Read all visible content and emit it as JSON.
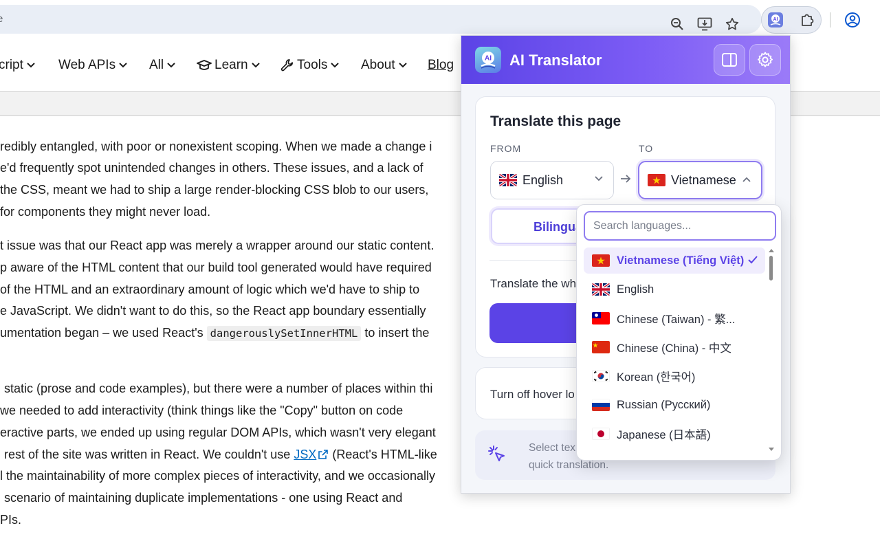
{
  "browser": {
    "omnibox_text": "e",
    "zoom_icon": "zoom-icon",
    "install_icon": "install-app-icon",
    "bookmark_icon": "star-icon",
    "extension_icon": "ai-translator-extension-icon",
    "extensions_icon": "puzzle-icon",
    "profile_icon": "profile-icon"
  },
  "nav": {
    "items": [
      {
        "label": "cript"
      },
      {
        "label": "Web APIs"
      },
      {
        "label": "All"
      },
      {
        "label": "Learn"
      },
      {
        "label": "Tools"
      },
      {
        "label": "About"
      },
      {
        "label": "Blog"
      }
    ]
  },
  "article": {
    "lines": [
      "redibly entangled, with poor or nonexistent scoping. When we made a change i",
      "e'd frequently spot unintended changes in others. These issues, and a lack of",
      "the CSS, meant we had to ship a large render-blocking CSS blob to our users,",
      "for components they might never load.",
      "t issue was that our React app was merely a wrapper around our static content.",
      "p aware of the HTML content that our build tool generated would have required",
      "of the HTML and an extraordinary amount of logic which we'd have to ship to",
      "e JavaScript. We didn't want to do this, so the React app boundary essentially",
      "umentation began – we used React's",
      "dangerouslySetInnerHTML",
      "to insert the",
      "static (prose and code examples), but there were a number of places within thi",
      "we needed to add interactivity (think things like the \"Copy\" button on code",
      "eractive parts, we ended up using regular DOM APIs, which wasn't very elegant",
      "rest of the site was written in React. We couldn't use",
      "JSX",
      "(React's HTML-like",
      "l the maintainability of more complex pieces of interactivity, and we occasionally",
      "scenario of maintaining duplicate implementations - one using React and",
      "PIs."
    ]
  },
  "panel": {
    "title": "AI Translator",
    "card_title": "Translate this page",
    "from_label": "FROM",
    "to_label": "TO",
    "from_lang": "English",
    "to_lang": "Vietnamese",
    "mode_label": "Bilingua",
    "translate_text": "Translate the wh",
    "hover_text": "Turn off hover lo",
    "hint_line1": "Select tex",
    "hint_line2": "quick translation."
  },
  "dropdown": {
    "search_placeholder": "Search languages...",
    "options": [
      {
        "label": "Vietnamese (Tiếng Việt)",
        "flag": "vietnam-flag",
        "selected": true
      },
      {
        "label": "English",
        "flag": "uk-flag",
        "selected": false
      },
      {
        "label": "Chinese (Taiwan) - 繁...",
        "flag": "taiwan-flag",
        "selected": false
      },
      {
        "label": "Chinese (China) - 中文",
        "flag": "china-flag",
        "selected": false
      },
      {
        "label": "Korean (한국어)",
        "flag": "korea-flag",
        "selected": false
      },
      {
        "label": "Russian (Русский)",
        "flag": "russia-flag",
        "selected": false
      },
      {
        "label": "Japanese (日本語)",
        "flag": "japan-flag",
        "selected": false
      }
    ]
  },
  "colors": {
    "accent": "#5b43e6",
    "header_gradient_start": "#5b43e6",
    "header_gradient_end": "#9b7bf8",
    "link": "#0069c2"
  }
}
